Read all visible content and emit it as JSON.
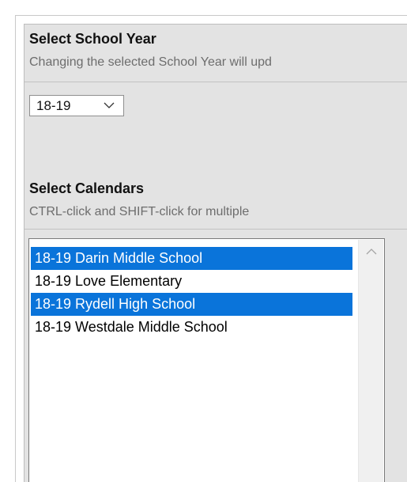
{
  "school_year": {
    "heading": "Select School Year",
    "description": "Changing the selected School Year will upd",
    "select": {
      "selected_value": "18-19",
      "icon": "chevron-down-icon"
    }
  },
  "calendars": {
    "heading": "Select Calendars",
    "description": "CTRL-click and SHIFT-click for multiple",
    "items": [
      {
        "label": "18-19 Darin Middle School",
        "selected": true
      },
      {
        "label": "18-19 Love Elementary",
        "selected": false
      },
      {
        "label": "18-19 Rydell High School",
        "selected": true
      },
      {
        "label": "18-19 Westdale Middle School",
        "selected": false
      }
    ],
    "scroll_icon": "chevron-up-icon"
  },
  "colors": {
    "selection": "#0a74da",
    "panel_bg": "#e3e3e3",
    "muted_text": "#6d6d6d"
  }
}
